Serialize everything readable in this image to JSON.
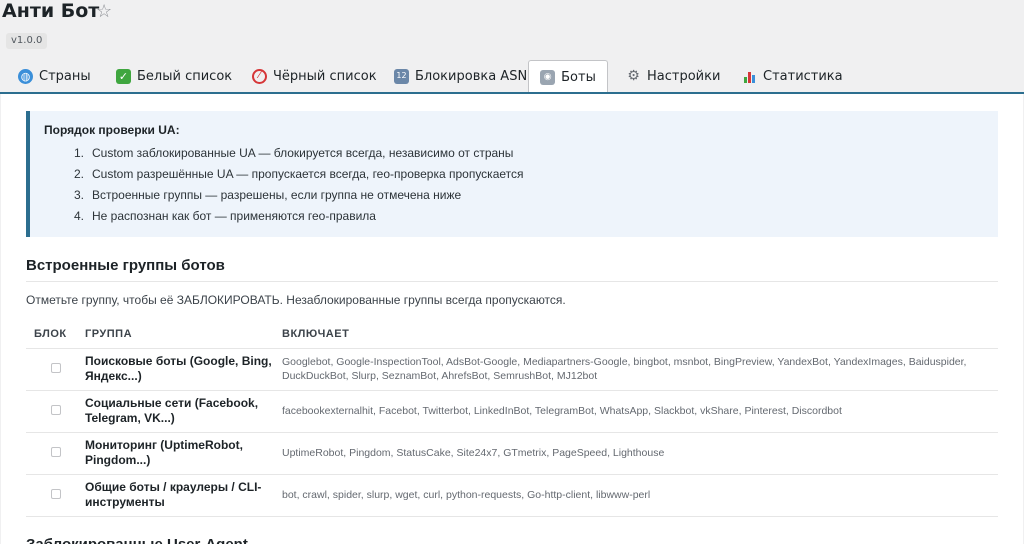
{
  "header": {
    "title": "Анти Бот",
    "version": "v1.0.0"
  },
  "tabs": [
    {
      "label": "Страны",
      "icon": "globe-icon"
    },
    {
      "label": "Белый список",
      "icon": "check-mark-icon"
    },
    {
      "label": "Чёрный список",
      "icon": "prohibited-icon"
    },
    {
      "label": "Блокировка ASN",
      "icon": "numbers-icon"
    },
    {
      "label": "Боты",
      "icon": "robot-icon",
      "active": true
    },
    {
      "label": "Настройки",
      "icon": "gear-icon"
    },
    {
      "label": "Статистика",
      "icon": "bar-chart-icon"
    }
  ],
  "notice": {
    "title": "Порядок проверки UA:",
    "items": [
      {
        "num": "1.",
        "text": "Custom заблокированные UA — блокируется всегда, независимо от страны"
      },
      {
        "num": "2.",
        "text": "Custom разрешённые UA — пропускается всегда, гео-проверка пропускается"
      },
      {
        "num": "3.",
        "text": "Встроенные группы — разрешены, если группа не отмечена ниже"
      },
      {
        "num": "4.",
        "text": "Не распознан как бот — применяются гео-правила"
      }
    ]
  },
  "section": {
    "title": "Встроенные группы ботов",
    "description": "Отметьте группу, чтобы её ЗАБЛОКИРОВАТЬ. Незаблокированные группы всегда пропускаются."
  },
  "table": {
    "headers": {
      "block": "БЛОК",
      "group": "ГРУППА",
      "includes": "ВКЛЮЧАЕТ"
    },
    "rows": [
      {
        "checked": false,
        "group": "Поисковые боты (Google, Bing, Яндекс...)",
        "includes": "Googlebot, Google-InspectionTool, AdsBot-Google, Mediapartners-Google, bingbot, msnbot, BingPreview, YandexBot, YandexImages, Baiduspider, DuckDuckBot, Slurp, SeznamBot, AhrefsBot, SemrushBot, MJ12bot"
      },
      {
        "checked": false,
        "group": "Социальные сети (Facebook, Telegram, VK...)",
        "includes": "facebookexternalhit, Facebot, Twitterbot, LinkedInBot, TelegramBot, WhatsApp, Slackbot, vkShare, Pinterest, Discordbot"
      },
      {
        "checked": false,
        "group": "Мониторинг (UptimeRobot, Pingdom...)",
        "includes": "UptimeRobot, Pingdom, StatusCake, Site24x7, GTmetrix, PageSpeed, Lighthouse"
      },
      {
        "checked": false,
        "group": "Общие боты / краулеры / CLI-инструменты",
        "includes": "bot, crawl, spider, slurp, wget, curl, python-requests, Go-http-client, libwww-perl"
      }
    ]
  },
  "next_section_title": "Заблокированные User-Agent"
}
